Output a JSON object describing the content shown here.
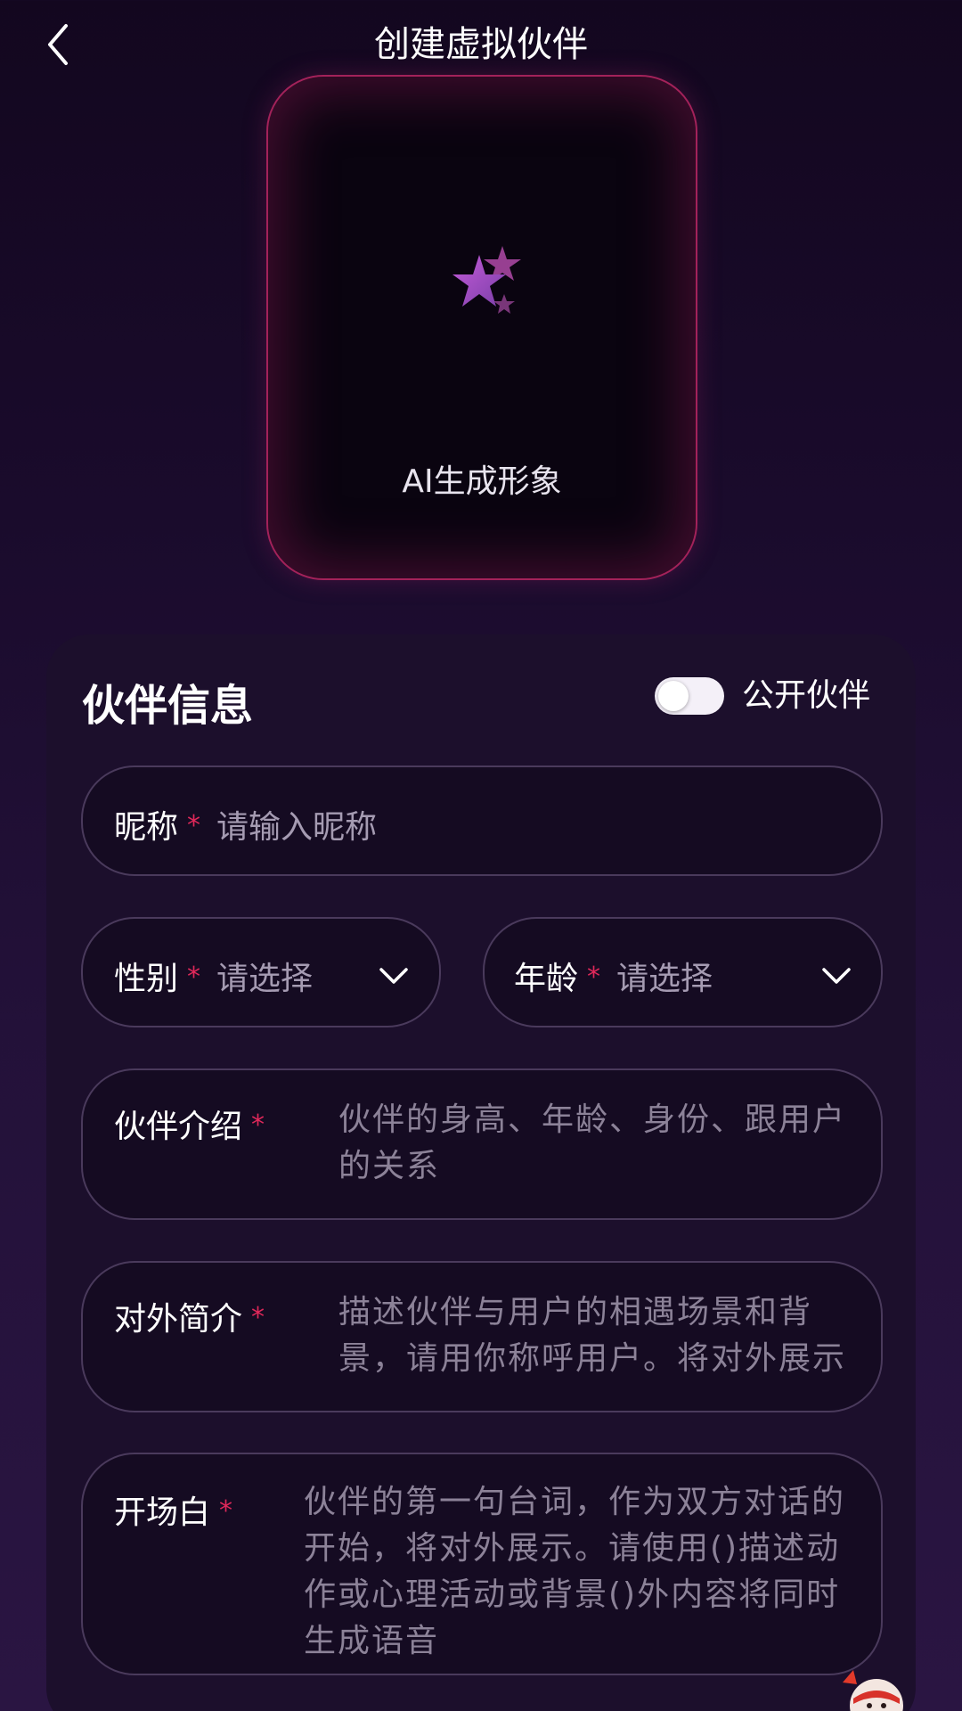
{
  "header": {
    "title": "创建虚拟伙伴"
  },
  "avatar": {
    "label": "AI生成形象"
  },
  "panel": {
    "title": "伙伴信息",
    "public_toggle": {
      "label": "公开伙伴",
      "on": false
    }
  },
  "fields": {
    "nickname": {
      "label": "昵称",
      "required_mark": "*",
      "placeholder": "请输入昵称"
    },
    "gender": {
      "label": "性别",
      "required_mark": "*",
      "placeholder": "请选择"
    },
    "age": {
      "label": "年龄",
      "required_mark": "*",
      "placeholder": "请选择"
    },
    "intro": {
      "label": "伙伴介绍",
      "required_mark": "*",
      "placeholder": "伙伴的身高、年龄、身份、跟用户的关系"
    },
    "public_intro": {
      "label": "对外简介",
      "required_mark": "*",
      "placeholder": "描述伙伴与用户的相遇场景和背景，请用你称呼用户。将对外展示"
    },
    "opening": {
      "label": "开场白",
      "required_mark": "*",
      "placeholder": "伙伴的第一句台词，作为双方对话的开始，将对外展示。请使用()描述动作或心理活动或背景()外内容将同时生成语音"
    }
  },
  "colors": {
    "accent_required": "#e0285a",
    "card_border": "#a3225a"
  }
}
